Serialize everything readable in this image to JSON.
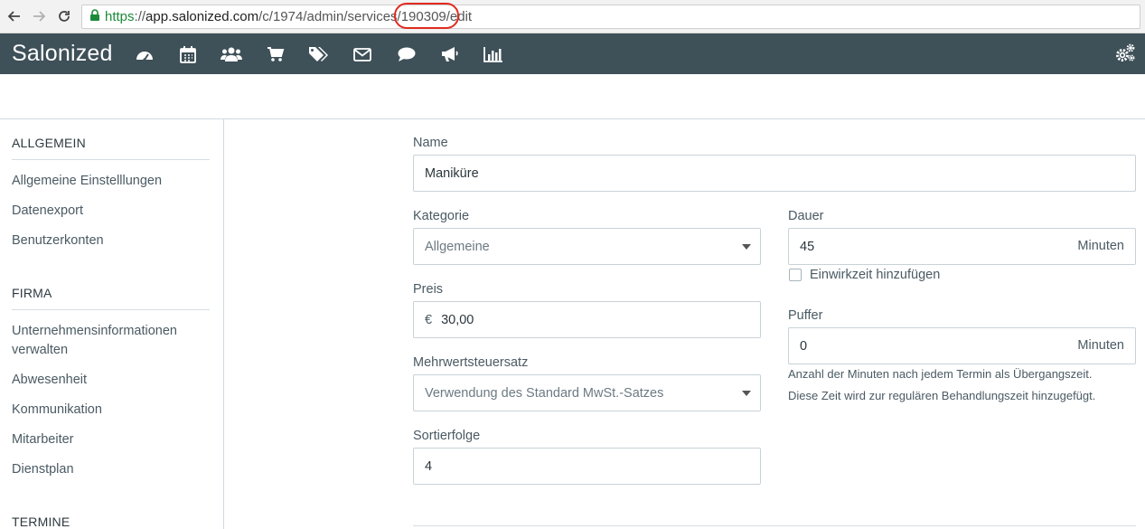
{
  "browser": {
    "url_scheme": "https",
    "url_sep": "://",
    "url_host": "app.salonized.com",
    "url_path": "/c/1974/admin/services/190309/edit"
  },
  "app": {
    "brand": "Salonized",
    "nav_icons": [
      "dashboard-icon",
      "calendar-icon",
      "users-icon",
      "cart-icon",
      "tags-icon",
      "envelope-icon",
      "chat-icon",
      "megaphone-icon",
      "bar-chart-icon"
    ],
    "settings_icon": "gears-icon",
    "header_color": "#3e5058",
    "annotation_color": "#e02b20"
  },
  "sidebar": {
    "sections": [
      {
        "title": "ALLGEMEIN",
        "items": [
          "Allgemeine Einstelllungen",
          "Datenexport",
          "Benutzerkonten"
        ]
      },
      {
        "title": "FIRMA",
        "items": [
          "Unternehmensinformationen verwalten",
          "Abwesenheit",
          "Kommunikation",
          "Mitarbeiter",
          "Dienstplan"
        ]
      },
      {
        "title": "TERMINE",
        "items": []
      }
    ]
  },
  "form": {
    "name": {
      "label": "Name",
      "value": "Maniküre"
    },
    "kategorie": {
      "label": "Kategorie",
      "value": "Allgemeine"
    },
    "dauer": {
      "label": "Dauer",
      "value": "45",
      "suffix": "Minuten"
    },
    "einwirkzeit": {
      "label": "Einwirkzeit hinzufügen",
      "checked": false
    },
    "preis": {
      "label": "Preis",
      "currency": "€",
      "value": "30,00"
    },
    "puffer": {
      "label": "Puffer",
      "value": "0",
      "suffix": "Minuten",
      "help_1": "Anzahl der Minuten nach jedem Termin als Übergangszeit.",
      "help_2": "Diese Zeit wird zur regulären Behandlungszeit hinzugefügt."
    },
    "mwst": {
      "label": "Mehrwertsteuersatz",
      "value": "Verwendung des Standard MwSt.-Satzes"
    },
    "sortierfolge": {
      "label": "Sortierfolge",
      "value": "4"
    }
  }
}
